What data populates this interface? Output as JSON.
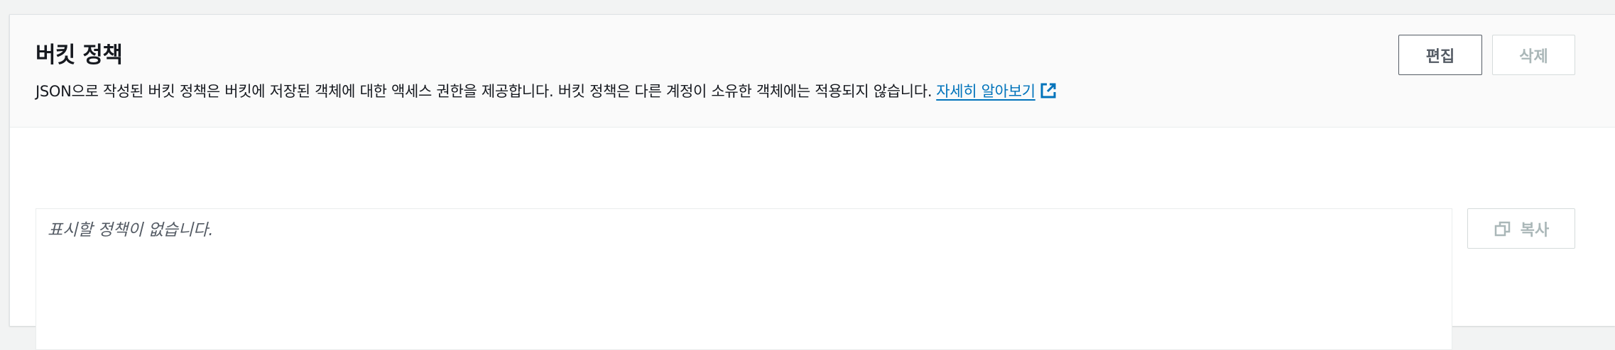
{
  "header": {
    "title": "버킷 정책",
    "description": "JSON으로 작성된 버킷 정책은 버킷에 저장된 객체에 대한 액세스 권한을 제공합니다. 버킷 정책은 다른 계정이 소유한 객체에는 적용되지 않습니다.",
    "learn_more": "자세히 알아보기",
    "learn_more_icon": "external-link-icon"
  },
  "actions": {
    "edit_label": "편집",
    "delete_label": "삭제"
  },
  "policy": {
    "empty_text": "표시할 정책이 없습니다.",
    "copy_label": "복사",
    "copy_icon": "copy-icon"
  },
  "colors": {
    "link": "#0073bb",
    "disabled": "#aab7b8",
    "primary_text": "#16191f"
  }
}
